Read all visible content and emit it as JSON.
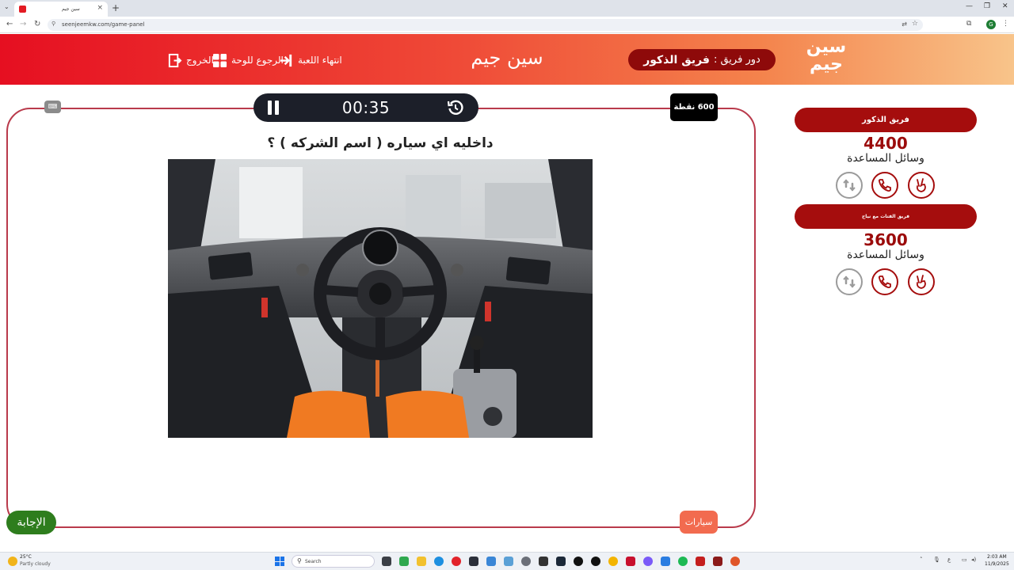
{
  "browser": {
    "tab_title": "سين جيم",
    "url": "seenjeemkw.com/game-panel",
    "profile_initial": "G"
  },
  "header": {
    "logo_text": "سين جيم",
    "turn_label": "دور فريق :",
    "turn_team": "فريق الذكور",
    "site_title": "سين جيم",
    "end_game": "انتهاء اللعبة",
    "back_to_board": "الرجوع للوحة",
    "exit": "الخروج"
  },
  "game": {
    "timer": "00:35",
    "points": "600 نقطة",
    "question": "داخليه اي سياره ( اسم الشركه ) ؟",
    "answer_button": "الإجابة",
    "category": "سيارات",
    "keyboard_label": "⌨"
  },
  "teams": [
    {
      "name": "فريق الذكور",
      "score": "4400",
      "aids_label": "وسائل المساعدة"
    },
    {
      "name": "فريق الفتات مع نياح",
      "score": "3600",
      "aids_label": "وسائل المساعدة"
    }
  ],
  "taskbar": {
    "weather_temp": "25°C",
    "weather_desc": "Partly cloudy",
    "search_placeholder": "Search",
    "time": "2:03 AM",
    "date": "11/9/2025"
  },
  "colors": {
    "header_start": "#e60f21",
    "header_end": "#f8c48a",
    "team_pill": "#a50d0d",
    "answer_green": "#2e7d1d",
    "category_orange": "#f26b4f",
    "board_border": "#b93a4b"
  }
}
